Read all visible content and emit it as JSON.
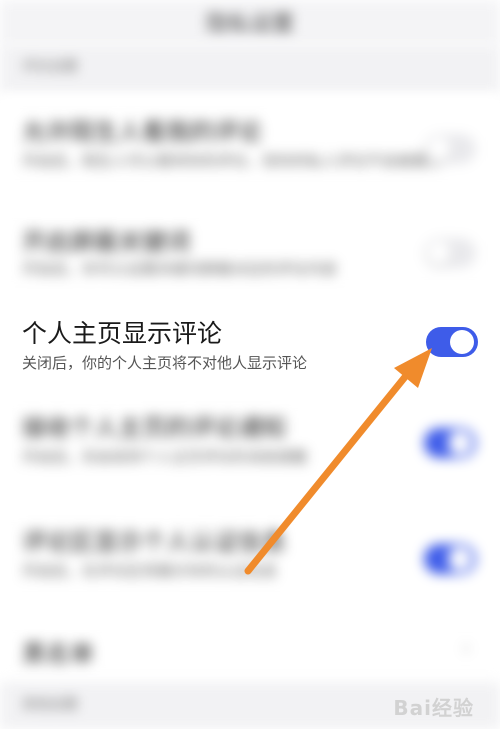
{
  "header": {
    "title": "隐私设置"
  },
  "sections": [
    {
      "label": "评论设置"
    },
    {
      "label": "其他设置"
    }
  ],
  "rows": [
    {
      "title": "允许陌生人看我的评论",
      "subtitle": "开启后，陌生人可以看到你的评论，但你的私人评论不会被展示",
      "switch": "off"
    },
    {
      "title": "开启屏蔽关键词",
      "subtitle": "开启后，你可以设置关键词屏蔽对应的评论内容",
      "switch": "off"
    },
    {
      "title": "个人主页显示评论",
      "subtitle": "关闭后，你的个人主页将不对他人显示评论",
      "switch": "on"
    },
    {
      "title": "接收个人主页的评论通知",
      "subtitle": "开启后，你会收到个人主页评论的消息提醒",
      "switch": "on"
    },
    {
      "title": "评论区显示个人认证信息",
      "subtitle": "开启后，在评论区将展示你的认证信息",
      "switch": "on"
    },
    {
      "title": "黑名单",
      "subtitle": "",
      "switch": "none"
    }
  ],
  "watermark": {
    "text": "Bai经验"
  },
  "colors": {
    "accent": "#3e5ce9",
    "arrow": "#f08b2c"
  }
}
